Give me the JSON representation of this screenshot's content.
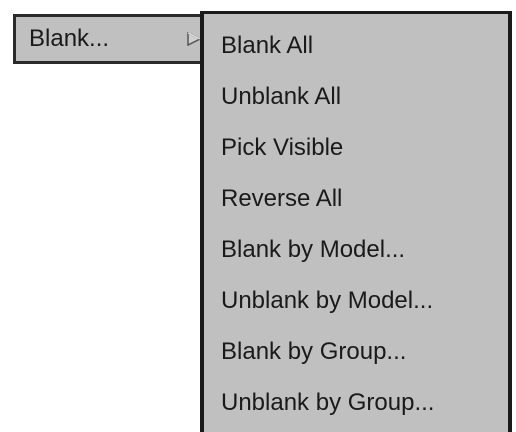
{
  "parent_menu": {
    "label": "Blank...",
    "arrow_icon": "cascade-arrow-icon"
  },
  "submenu": {
    "items": [
      {
        "label": "Blank All"
      },
      {
        "label": "Unblank All"
      },
      {
        "label": "Pick Visible"
      },
      {
        "label": "Reverse All"
      },
      {
        "label": "Blank by Model..."
      },
      {
        "label": "Unblank by Model..."
      },
      {
        "label": "Blank by Group..."
      },
      {
        "label": "Unblank by Group..."
      }
    ]
  },
  "colors": {
    "menu_background": "#c0c0c0",
    "border": "#1a1a1a",
    "text": "#1a1a1a"
  }
}
